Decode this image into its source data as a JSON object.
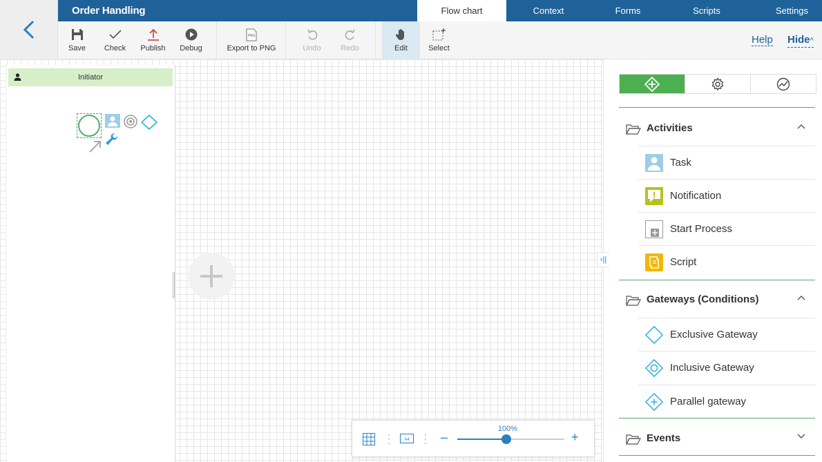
{
  "header": {
    "title": "Order Handling",
    "tabs": [
      {
        "label": "Flow chart",
        "active": true
      },
      {
        "label": "Context"
      },
      {
        "label": "Forms"
      },
      {
        "label": "Scripts"
      },
      {
        "label": "Settings"
      }
    ]
  },
  "toolbar": {
    "save": "Save",
    "check": "Check",
    "publish": "Publish",
    "debug": "Debug",
    "export": "Export to PNG",
    "export_icon_text": "PNG",
    "undo": "Undo",
    "redo": "Redo",
    "edit": "Edit",
    "select": "Select",
    "help": "Help",
    "hide": "Hide",
    "hide_chevron": "^"
  },
  "canvas": {
    "lane_name": "Initiator",
    "zoom": {
      "percent_label": "100%",
      "level": 0.46,
      "a4_label": "A4",
      "minus": "–",
      "plus": "+"
    },
    "collapse_label": "›||"
  },
  "panel": {
    "tabs": [
      {
        "icon": "elements-icon",
        "active": true
      },
      {
        "icon": "gear-icon"
      },
      {
        "icon": "chart-icon"
      }
    ],
    "sections": [
      {
        "name": "Activities",
        "expanded": true,
        "items": [
          {
            "name": "Task",
            "icon": "task-icon"
          },
          {
            "name": "Notification",
            "icon": "notification-icon"
          },
          {
            "name": "Start Process",
            "icon": "start-process-icon"
          },
          {
            "name": "Script",
            "icon": "script-icon"
          }
        ]
      },
      {
        "name": "Gateways (Conditions)",
        "expanded": true,
        "items": [
          {
            "name": "Exclusive Gateway",
            "icon": "exclusive-gateway-icon"
          },
          {
            "name": "Inclusive Gateway",
            "icon": "inclusive-gateway-icon"
          },
          {
            "name": "Parallel gateway",
            "icon": "parallel-gateway-icon"
          }
        ]
      },
      {
        "name": "Events",
        "expanded": false,
        "items": []
      }
    ]
  },
  "colors": {
    "header_blue": "#1f6299",
    "accent_blue": "#2a7fc0",
    "green": "#4caf50",
    "lane_green": "#d6efc9"
  }
}
